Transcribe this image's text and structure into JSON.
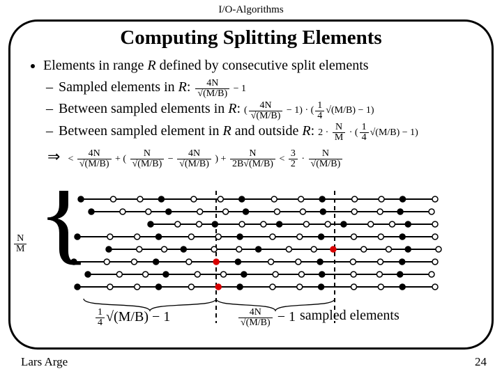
{
  "header": "I/O-Algorithms",
  "title": "Computing Splitting Elements",
  "bullets": {
    "main": "Elements in range R defined by consecutive split elements",
    "sub1": "Sampled elements in R:",
    "sub2": "Between sampled elements in R:",
    "sub3": "Between sampled element in R and outside R:"
  },
  "formulas": {
    "f1_top": "4N",
    "f1_bot": "√(M/B)",
    "f1_tail": " − 1",
    "f2_head": "(",
    "f2a_top": "4N",
    "f2a_bot": "√(M/B)",
    "f2_mid": " − 1) · (",
    "f2b_top": "1",
    "f2b_bot": "4",
    "f2c": "√(M/B)",
    "f2_tail": " − 1)",
    "f3_head": "2 · ",
    "f3a_top": "N",
    "f3a_bot": "M",
    "f3_mid1": " · (",
    "f3b_top": "1",
    "f3b_bot": "4",
    "f3c": "√(M/B)",
    "f3_tail": " − 1)",
    "imp_lt": " < ",
    "imp_a_top": "4N",
    "imp_a_bot": "√(M/B)",
    "imp_plus1": " + (",
    "imp_b_top": "N",
    "imp_b_bot": "√(M/B)",
    "imp_minus": " − ",
    "imp_c_top": "4N",
    "imp_c_bot": "√(M/B)",
    "imp_plus2": ") + ",
    "imp_d_top": "N",
    "imp_d_bot": "2B√(M/B)",
    "imp_lt2": " < ",
    "imp_e_top": "3",
    "imp_e_bot": "2",
    "imp_dot": " · ",
    "imp_f_top": "N",
    "imp_f_bot": "√(M/B)"
  },
  "diagram_labels": {
    "left_top": "N",
    "left_bot": "M",
    "bracket_left_a": "1",
    "bracket_left_b": "4",
    "bracket_left_c": "√(M/B) − 1",
    "bracket_right_a": "4N",
    "bracket_right_b": "√(M/B)",
    "bracket_right_c": " − 1",
    "caption": "sampled elements"
  },
  "author": "Lars Arge",
  "page": "24"
}
